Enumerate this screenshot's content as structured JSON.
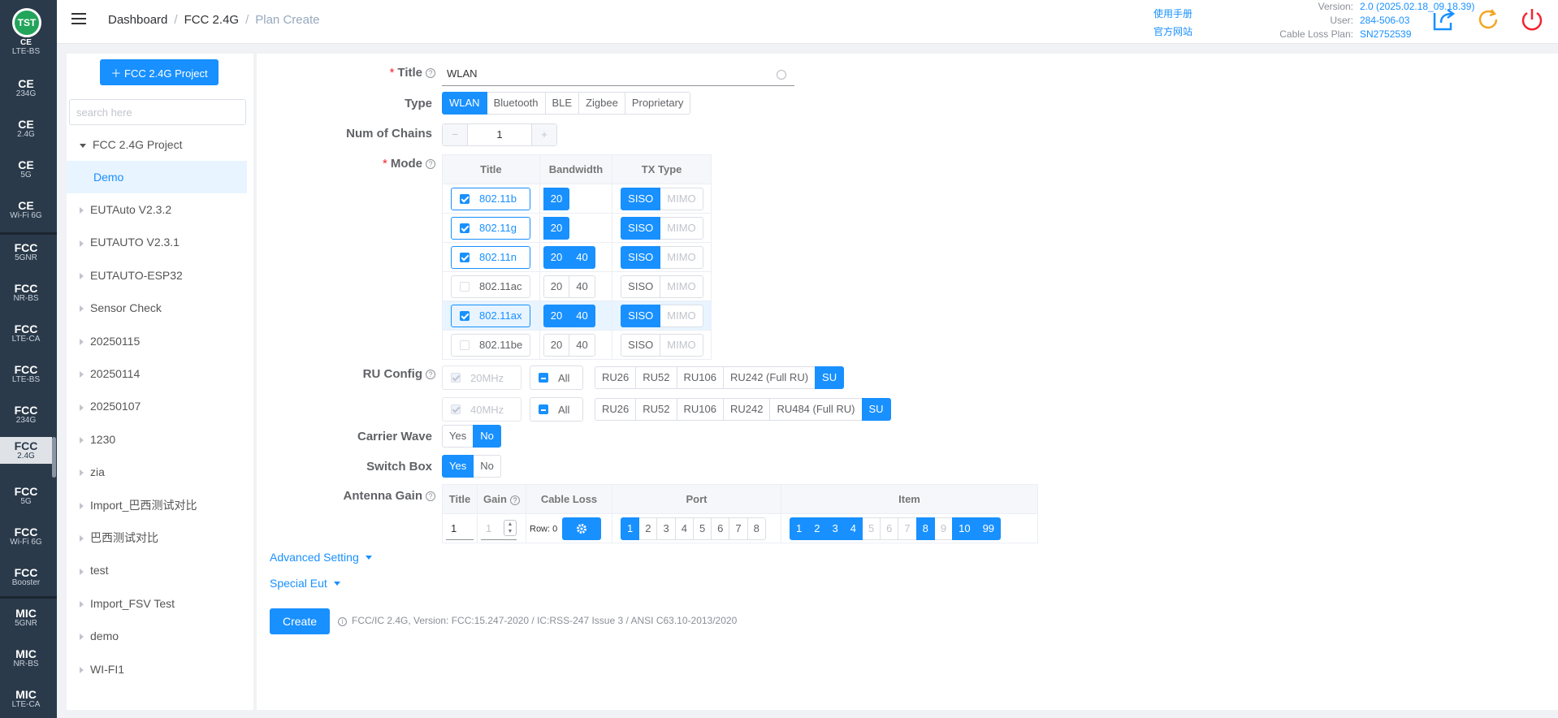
{
  "logo": "TST",
  "rail": [
    {
      "t": "CE",
      "s": "LTE-BS"
    },
    {
      "t": "CE",
      "s": "234G"
    },
    {
      "t": "CE",
      "s": "2.4G"
    },
    {
      "t": "CE",
      "s": "5G"
    },
    {
      "t": "CE",
      "s": "Wi-Fi 6G"
    },
    {
      "t": "FCC",
      "s": "5GNR"
    },
    {
      "t": "FCC",
      "s": "NR-BS"
    },
    {
      "t": "FCC",
      "s": "LTE-CA"
    },
    {
      "t": "FCC",
      "s": "LTE-BS"
    },
    {
      "t": "FCC",
      "s": "234G"
    },
    {
      "t": "FCC",
      "s": "2.4G"
    },
    {
      "t": "FCC",
      "s": "5G"
    },
    {
      "t": "FCC",
      "s": "Wi-Fi 6G"
    },
    {
      "t": "FCC",
      "s": "Booster"
    },
    {
      "t": "MIC",
      "s": "5GNR"
    },
    {
      "t": "MIC",
      "s": "NR-BS"
    },
    {
      "t": "MIC",
      "s": "LTE-CA"
    }
  ],
  "breadcrumb": [
    "Dashboard",
    "FCC 2.4G",
    "Plan Create"
  ],
  "header": {
    "manual": "使用手册",
    "website": "官方网站",
    "version_label": "Version:",
    "version": "2.0 (2025.02.18_09.18.39)",
    "user_label": "User:",
    "user": "284-506-03",
    "cable_label": "Cable Loss Plan:",
    "cable": "SN2752539"
  },
  "tree": {
    "project_button": "＋  FCC 2.4G Project",
    "search_placeholder": "search here",
    "root": "FCC 2.4G Project",
    "selected": "Demo",
    "nodes": [
      "EUTAuto V2.3.2",
      "EUTAUTO V2.3.1",
      "EUTAUTO-ESP32",
      "Sensor Check",
      "20250115",
      "20250114",
      "20250107",
      "1230",
      "zia",
      "Import_巴西测试对比",
      "巴西测试对比",
      "test",
      "Import_FSV Test",
      "demo",
      "WI-FI1"
    ]
  },
  "form": {
    "title_label": "Title",
    "title_value": "WLAN",
    "type_label": "Type",
    "types": [
      "WLAN",
      "Bluetooth",
      "BLE",
      "Zigbee",
      "Proprietary"
    ],
    "type_selected": "WLAN",
    "chains_label": "Num of Chains",
    "chains_value": "1",
    "mode_label": "Mode",
    "mode_headers": [
      "Title",
      "Bandwidth",
      "TX Type"
    ],
    "modes": [
      {
        "name": "802.11b",
        "checked": true,
        "bw": [
          "20"
        ],
        "bw_on": [
          true
        ],
        "tx_on": true
      },
      {
        "name": "802.11g",
        "checked": true,
        "bw": [
          "20"
        ],
        "bw_on": [
          true
        ],
        "tx_on": true
      },
      {
        "name": "802.11n",
        "checked": true,
        "bw": [
          "20",
          "40"
        ],
        "bw_on": [
          true,
          true
        ],
        "tx_on": true
      },
      {
        "name": "802.11ac",
        "checked": false,
        "bw": [
          "20",
          "40"
        ],
        "bw_on": [
          false,
          false
        ],
        "tx_on": false
      },
      {
        "name": "802.11ax",
        "checked": true,
        "bw": [
          "20",
          "40"
        ],
        "bw_on": [
          true,
          true
        ],
        "tx_on": true
      },
      {
        "name": "802.11be",
        "checked": false,
        "bw": [
          "20",
          "40"
        ],
        "bw_on": [
          false,
          false
        ],
        "tx_on": false
      }
    ],
    "tx_types": [
      "SISO",
      "MIMO"
    ],
    "ru_label": "RU Config",
    "ru_all": "All",
    "ru_rows": [
      {
        "bw": "20MHz",
        "items": [
          "RU26",
          "RU52",
          "RU106",
          "RU242 (Full RU)",
          "SU"
        ]
      },
      {
        "bw": "40MHz",
        "items": [
          "RU26",
          "RU52",
          "RU106",
          "RU242",
          "RU484 (Full RU)",
          "SU"
        ]
      }
    ],
    "carrier_label": "Carrier Wave",
    "carrier_options": [
      "Yes",
      "No"
    ],
    "carrier_selected": "No",
    "switch_label": "Switch Box",
    "switch_options": [
      "Yes",
      "No"
    ],
    "switch_selected": "Yes",
    "antenna_label": "Antenna Gain",
    "antenna_headers": [
      "Title",
      "Gain",
      "Cable Loss",
      "Port",
      "Item"
    ],
    "antenna_title": "1",
    "antenna_gain": "1",
    "cable_loss_row": "Row: 0",
    "ports": [
      "1",
      "2",
      "3",
      "4",
      "5",
      "6",
      "7",
      "8"
    ],
    "ports_on": [
      "1"
    ],
    "items": [
      "1",
      "2",
      "3",
      "4",
      "5",
      "6",
      "7",
      "8",
      "9",
      "10",
      "99"
    ],
    "items_on": [
      "1",
      "2",
      "3",
      "4",
      "8",
      "10",
      "99"
    ],
    "items_dis": [
      "5",
      "6",
      "7",
      "9"
    ],
    "advanced": "Advanced Setting",
    "special": "Special Eut",
    "create": "Create",
    "footnote": "FCC/IC 2.4G, Version: FCC:15.247-2020 / IC:RSS-247 Issue 3 / ANSI C63.10-2013/2020"
  }
}
